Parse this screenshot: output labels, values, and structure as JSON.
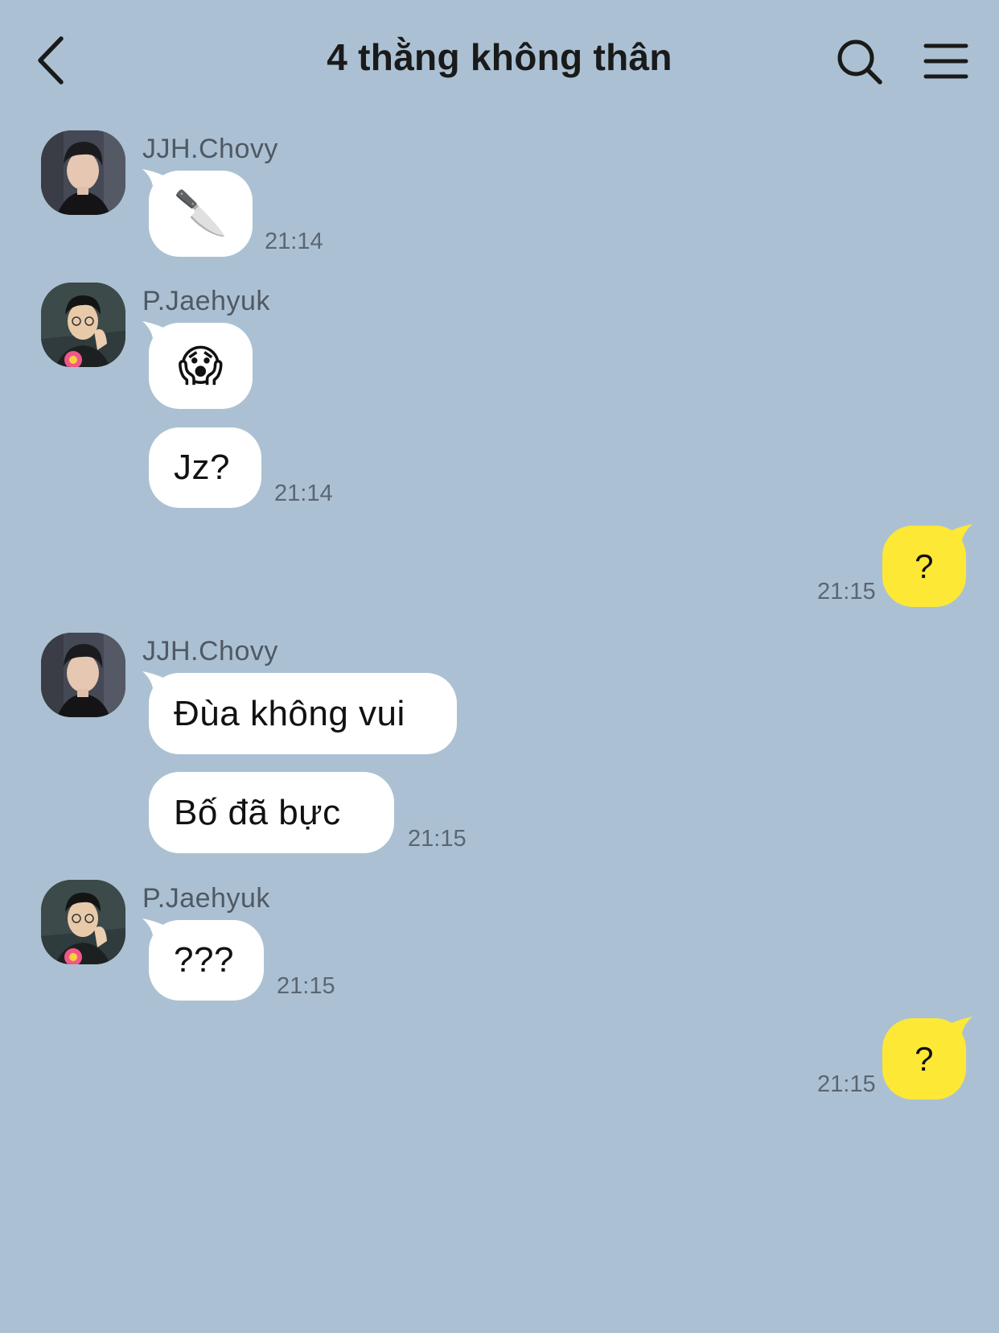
{
  "header": {
    "title": "4 thằng không thân",
    "back_icon": "chevron-left-icon",
    "search_icon": "search-icon",
    "menu_icon": "hamburger-menu-icon"
  },
  "colors": {
    "background": "#abc1d3",
    "incoming_bubble": "#ffffff",
    "outgoing_bubble": "#fde836",
    "timestamp": "#5b6673",
    "sender_name": "#4f5964"
  },
  "messages": [
    {
      "sender": "JJH.Chovy",
      "text": "🔪",
      "time": "21:14"
    },
    {
      "sender": "P.Jaehyuk",
      "text": "😱"
    },
    {
      "sender": "P.Jaehyuk",
      "text": "Jz?",
      "time": "21:14"
    },
    {
      "sender": "me",
      "text": "?",
      "time": "21:15"
    },
    {
      "sender": "JJH.Chovy",
      "text": "Đùa không vui"
    },
    {
      "sender": "JJH.Chovy",
      "text": "Bố đã bực",
      "time": "21:15"
    },
    {
      "sender": "P.Jaehyuk",
      "text": "???",
      "time": "21:15"
    },
    {
      "sender": "me",
      "text": "?",
      "time": "21:15"
    }
  ]
}
